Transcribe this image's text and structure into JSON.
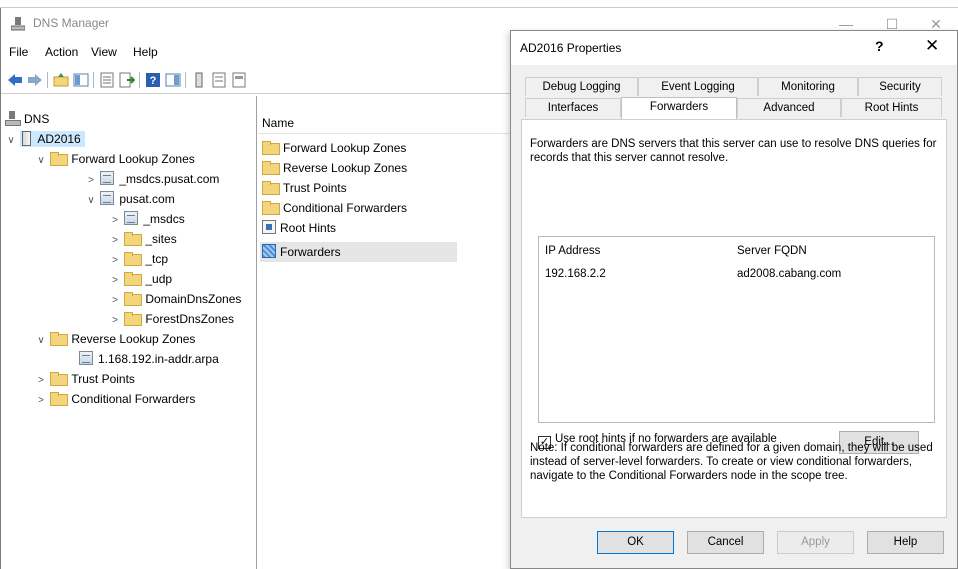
{
  "window": {
    "title": "DNS Manager",
    "controls": {
      "minimize": "—",
      "maximize": "☐",
      "close": "✕"
    }
  },
  "menu": [
    "File",
    "Action",
    "View",
    "Help"
  ],
  "tree": {
    "root": "DNS",
    "server": "AD2016",
    "forward_zones": "Forward Lookup Zones",
    "msdcs_zone": "_msdcs.pusat.com",
    "pusat_zone": "pusat.com",
    "pusat_children": [
      "_msdcs",
      "_sites",
      "_tcp",
      "_udp",
      "DomainDnsZones",
      "ForestDnsZones"
    ],
    "reverse_zones": "Reverse Lookup Zones",
    "reverse_child": "1.168.192.in-addr.arpa",
    "trust_points": "Trust Points",
    "conditional_forwarders": "Conditional Forwarders"
  },
  "list": {
    "header": "Name",
    "items": [
      "Forward Lookup Zones",
      "Reverse Lookup Zones",
      "Trust Points",
      "Conditional Forwarders",
      "Root Hints",
      "Forwarders"
    ]
  },
  "dialog": {
    "title": "AD2016 Properties",
    "help_glyph": "?",
    "close_glyph": "✕",
    "tabs_row1": [
      "Debug Logging",
      "Event Logging",
      "Monitoring",
      "Security"
    ],
    "tabs_row2": [
      "Interfaces",
      "Forwarders",
      "Advanced",
      "Root Hints"
    ],
    "active_tab": "Forwarders",
    "description": "Forwarders are DNS servers that this server can use to resolve DNS queries for records that this server cannot resolve.",
    "columns": [
      "IP Address",
      "Server FQDN"
    ],
    "forwarders": [
      {
        "ip": "192.168.2.2",
        "fqdn": "ad2008.cabang.com"
      }
    ],
    "use_root_hints_label": "Use root hints if no forwarders are available",
    "use_root_hints_checked": true,
    "check_glyph": "✓",
    "edit_button": "Edit...",
    "note": "Note: If conditional forwarders are defined for a given domain, they will be used instead of server-level forwarders.  To create or view conditional forwarders, navigate to the Conditional Forwarders node in the scope tree.",
    "buttons": {
      "ok": "OK",
      "cancel": "Cancel",
      "apply": "Apply",
      "help": "Help"
    }
  },
  "colors": {
    "selection": "#cce8ff",
    "focus_border": "#0078d7",
    "dialog_bg": "#f0f0f0"
  }
}
